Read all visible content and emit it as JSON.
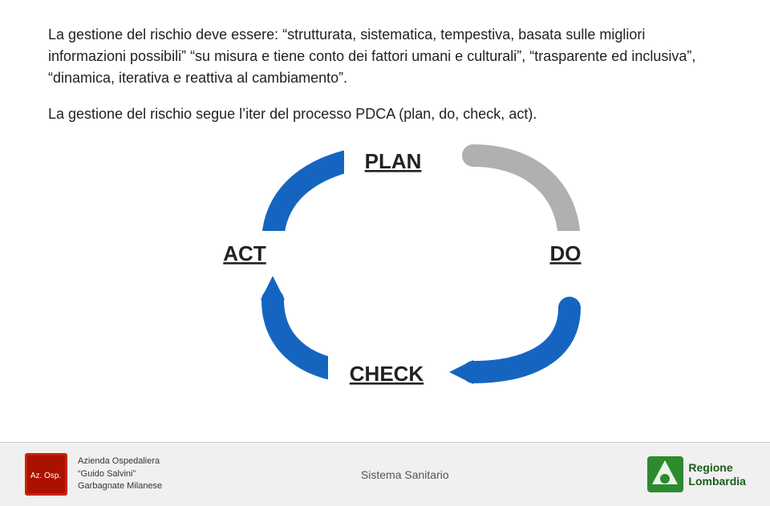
{
  "content": {
    "paragraph1": "La gestione del rischio deve essere: “strutturata, sistematica, tempestiva, basata sulle migliori informazioni possibili” “su misura e tiene conto dei fattori umani e culturali”, “trasparente ed inclusiva”, “dinamica, iterativa e reattiva al cambiamento”.",
    "paragraph2": "La gestione del rischio segue l’iter del processo PDCA (plan, do, check, act).",
    "pdca": {
      "plan": "PLAN",
      "do": "DO",
      "act": "ACT",
      "check": "CHECK"
    }
  },
  "footer": {
    "hospital_name": "Azienda Ospedaliera",
    "hospital_subtitle": "“Guido Salvini”",
    "hospital_location": "Garbagnate Milanese",
    "sistema_label": "Sistema Sanitario",
    "regione_label": "Regione",
    "lombardia_label": "Lombardia"
  },
  "colors": {
    "blue": "#1565c0",
    "blue_arrow": "#1a6fcc",
    "gray_arrow": "#a0a0a0",
    "text": "#222222"
  }
}
